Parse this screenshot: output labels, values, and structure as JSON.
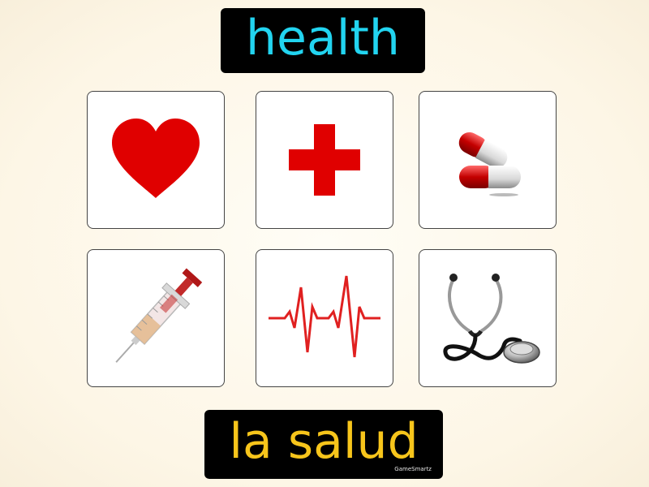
{
  "header": {
    "title": "health"
  },
  "footer": {
    "translation": "la salud",
    "brand": "GameSmartz"
  },
  "tiles": [
    {
      "icon": "heart-icon"
    },
    {
      "icon": "red-cross-icon"
    },
    {
      "icon": "pill-capsules-icon"
    },
    {
      "icon": "syringe-icon"
    },
    {
      "icon": "heartbeat-icon"
    },
    {
      "icon": "stethoscope-icon"
    }
  ],
  "colors": {
    "title_text": "#22d4f0",
    "translation_text": "#f7c51b",
    "box_background": "#000000",
    "icon_red": "#e00000"
  }
}
